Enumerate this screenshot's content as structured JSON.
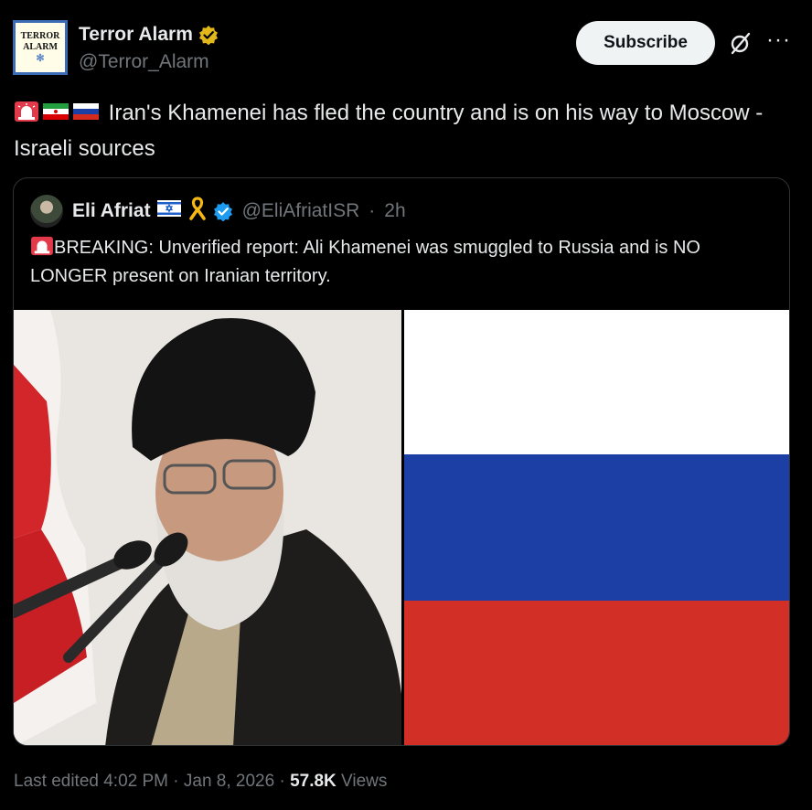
{
  "author": {
    "avatar_text_line1": "TERROR",
    "avatar_text_line2": "ALARM",
    "display_name": "Terror Alarm",
    "handle": "@Terror_Alarm"
  },
  "actions": {
    "subscribe_label": "Subscribe",
    "grok_icon": "grok-slash-icon",
    "more_icon": "more-icon"
  },
  "tweet": {
    "emojis": [
      "police-light-emoji",
      "iran-flag-emoji",
      "russia-flag-emoji"
    ],
    "text": "Iran's Khamenei has fled the country and is on his way to Moscow - Israeli sources"
  },
  "quote": {
    "display_name": "Eli Afriat",
    "badges": [
      "israel-flag-emoji",
      "yellow-ribbon-emoji",
      "verified-badge-icon"
    ],
    "handle": "@EliAfriatISR",
    "separator": "·",
    "time": "2h",
    "text": "BREAKING: Unverified report: Ali Khamenei was smuggled to Russia and is NO LONGER present on Iranian territory.",
    "images": [
      "khamenei-photo",
      "russia-flag-image"
    ]
  },
  "footer": {
    "edited": "Last edited 4:02 PM · Jan 8, 2026 · ",
    "views_count": "57.8K",
    "views_label": " Views"
  },
  "colors": {
    "background": "#000000",
    "text": "#e7e9ea",
    "muted": "#71767b",
    "verified_blue": "#1d9bf0",
    "verified_gold": "#e2b719",
    "border": "#2f3336"
  }
}
